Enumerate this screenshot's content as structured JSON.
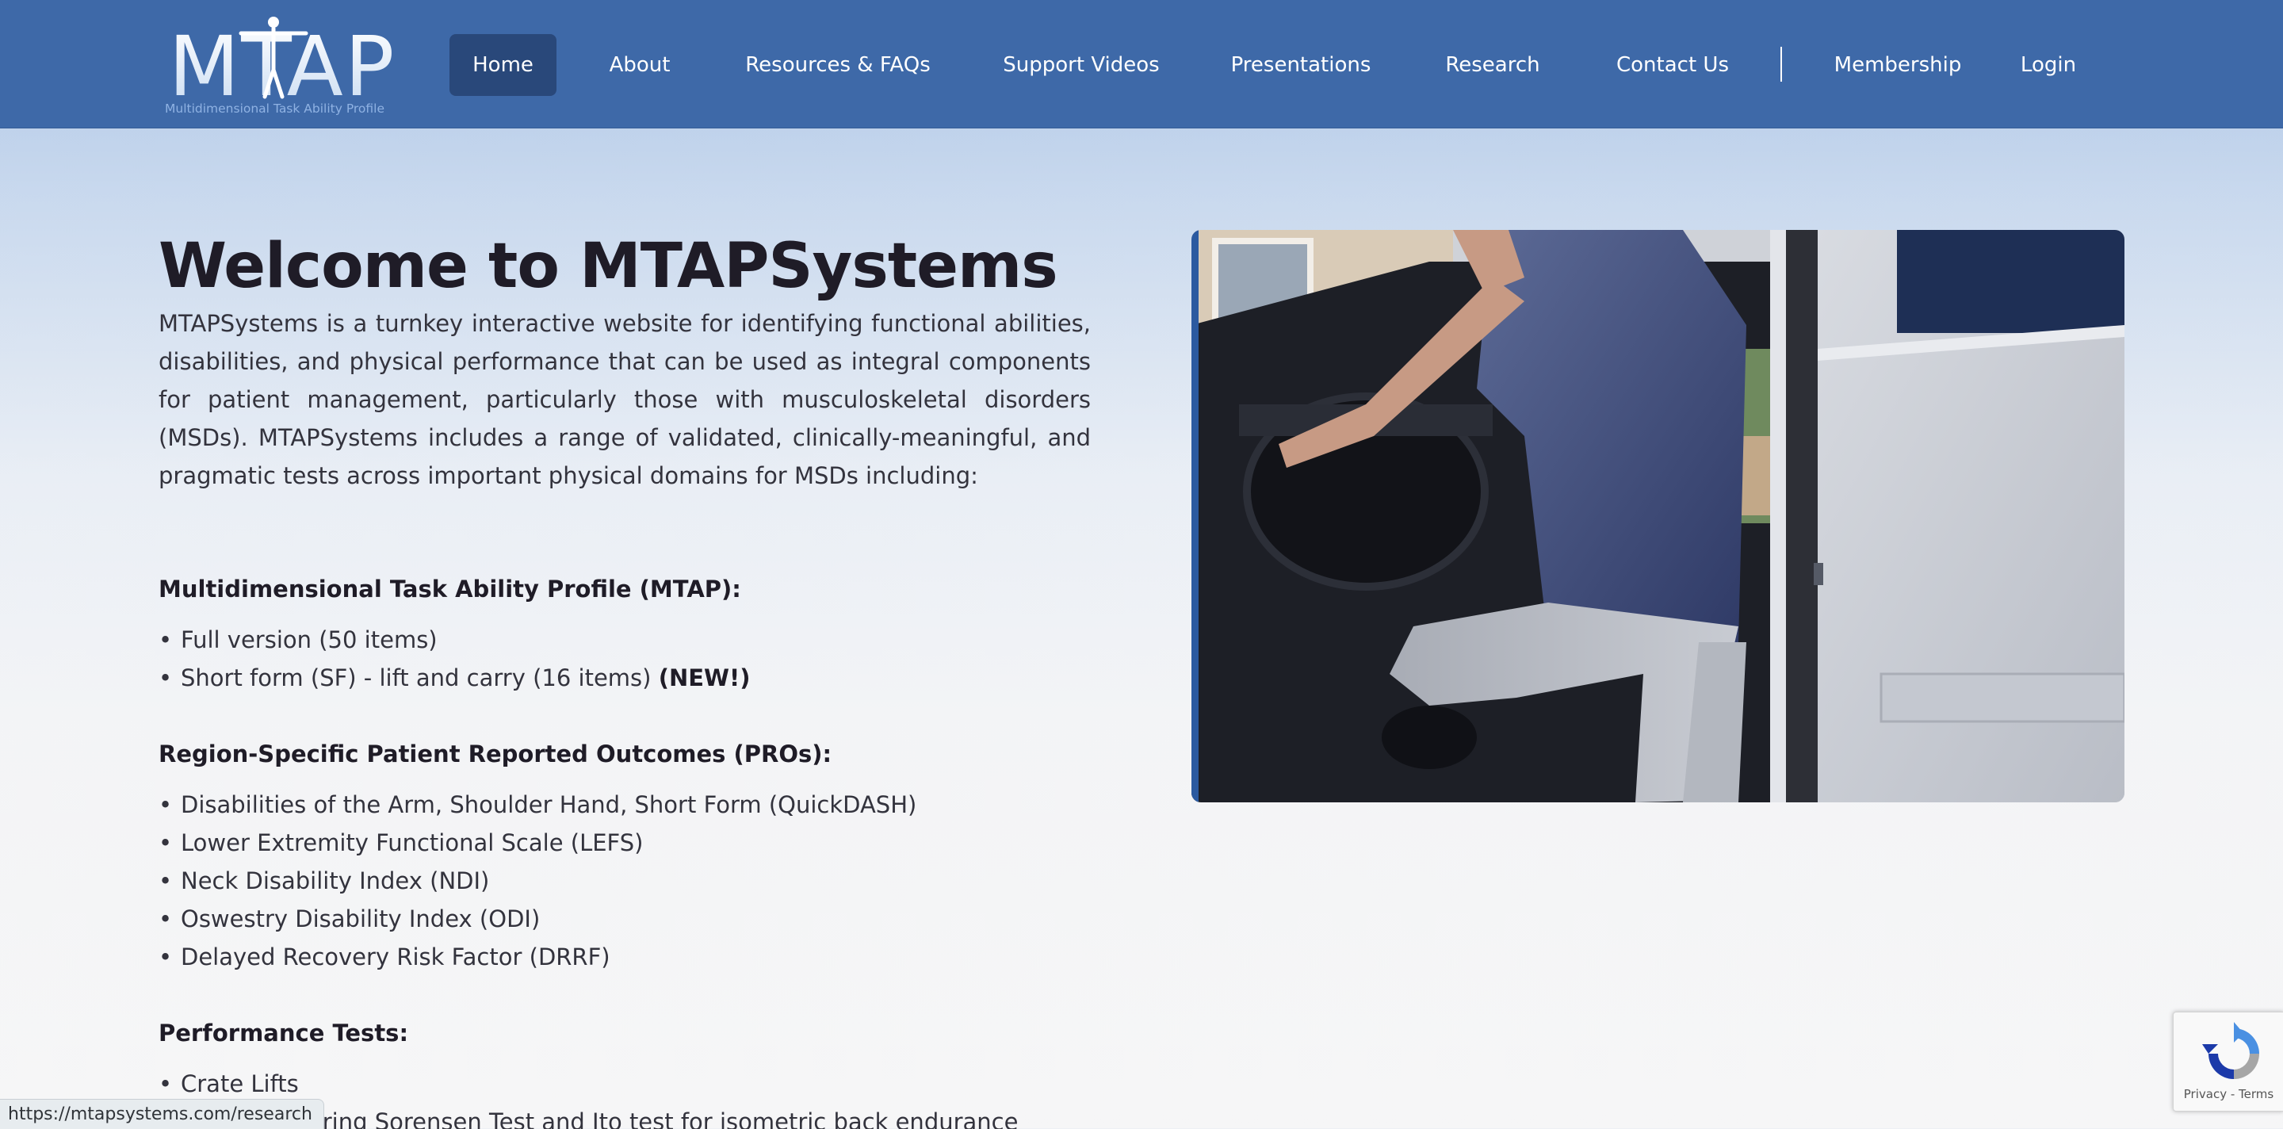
{
  "header": {
    "logo": {
      "wordmark": "MTAP",
      "tagline": "Multidimensional Task Ability Profile"
    },
    "nav": [
      {
        "label": "Home",
        "active": true
      },
      {
        "label": "About"
      },
      {
        "label": "Resources & FAQs"
      },
      {
        "label": "Support Videos"
      },
      {
        "label": "Presentations"
      },
      {
        "label": "Research"
      },
      {
        "label": "Contact Us"
      },
      {
        "label": "Membership"
      },
      {
        "label": "Login"
      }
    ]
  },
  "main": {
    "title": "Welcome to MTAPSystems",
    "intro": "MTAPSystems is a turnkey interactive website for identifying functional abilities, disabilities, and physical performance that can be used as integral components for patient management, particularly those with musculoskeletal disorders (MSDs). MTAPSystems includes a range of validated, clinically-meaningful, and pragmatic tests across important physical domains for MSDs including:",
    "sections": [
      {
        "heading": "Multidimensional Task Ability Profile (MTAP):",
        "items": [
          {
            "text": "Full version (50 items)"
          },
          {
            "text": "Short form (SF) - lift and carry (16 items) ",
            "badge": "(NEW!)"
          }
        ]
      },
      {
        "heading": "Region-Specific Patient Reported Outcomes (PROs):",
        "items": [
          {
            "text": "Disabilities of the Arm, Shoulder Hand, Short Form (QuickDASH)"
          },
          {
            "text": "Lower Extremity Functional Scale (LEFS)"
          },
          {
            "text": "Neck Disability Index (NDI)"
          },
          {
            "text": "Oswestry Disability Index (ODI)"
          },
          {
            "text": "Delayed Recovery Risk Factor (DRRF)"
          }
        ]
      },
      {
        "heading": "Performance Tests:",
        "items": [
          {
            "text": "Crate Lifts"
          },
          {
            "text": "Modified Biering Sorensen Test and Ito test for isometric back endurance"
          }
        ]
      }
    ],
    "hero_image": {
      "icon": "person-entering-vehicle-photo"
    }
  },
  "status_bar": {
    "url": "https://mtapsystems.com/research"
  },
  "recaptcha": {
    "icon": "recaptcha-icon",
    "privacy": "Privacy",
    "separator": " - ",
    "terms": "Terms"
  },
  "colors": {
    "nav_bg": "#3e69a8",
    "nav_active": "#29487a",
    "title": "#1f1c27",
    "body_text": "#33333d",
    "accent": "#2b5aa0"
  }
}
